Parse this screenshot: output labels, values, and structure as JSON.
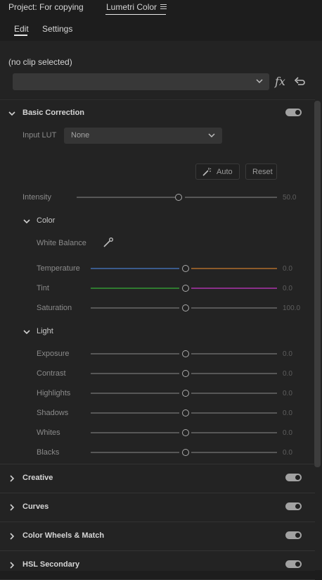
{
  "tabs": {
    "project": "Project: For copying",
    "lumetri": "Lumetri Color"
  },
  "subtabs": {
    "edit": "Edit",
    "settings": "Settings"
  },
  "clip": {
    "status": "(no clip selected)",
    "selected": ""
  },
  "basic": {
    "title": "Basic Correction",
    "input_lut_label": "Input LUT",
    "input_lut_value": "None",
    "auto_label": "Auto",
    "reset_label": "Reset",
    "intensity": {
      "label": "Intensity",
      "value": "50.0"
    },
    "color": {
      "title": "Color",
      "white_balance_label": "White Balance",
      "sliders": [
        {
          "label": "Temperature",
          "value": "0.0"
        },
        {
          "label": "Tint",
          "value": "0.0"
        },
        {
          "label": "Saturation",
          "value": "100.0"
        }
      ]
    },
    "light": {
      "title": "Light",
      "sliders": [
        {
          "label": "Exposure",
          "value": "0.0"
        },
        {
          "label": "Contrast",
          "value": "0.0"
        },
        {
          "label": "Highlights",
          "value": "0.0"
        },
        {
          "label": "Shadows",
          "value": "0.0"
        },
        {
          "label": "Whites",
          "value": "0.0"
        },
        {
          "label": "Blacks",
          "value": "0.0"
        }
      ]
    }
  },
  "collapsed_sections": [
    {
      "title": "Creative"
    },
    {
      "title": "Curves"
    },
    {
      "title": "Color Wheels & Match"
    },
    {
      "title": "HSL Secondary"
    }
  ],
  "colors": {
    "temperature_left": "#3a5a8c",
    "temperature_right": "#8c5a2a",
    "tint_left": "#2f7a2f",
    "tint_right": "#8a2f8a",
    "neutral_track": "#575757"
  },
  "icons": {
    "menu": "hamburger-icon",
    "dropdown": "chevron-down-icon",
    "fx": "fx-icon",
    "reset": "undo-icon",
    "wand": "magic-wand-icon",
    "eyedropper": "eyedropper-icon",
    "expand": "chevron-right-icon",
    "collapse": "chevron-down-icon"
  }
}
